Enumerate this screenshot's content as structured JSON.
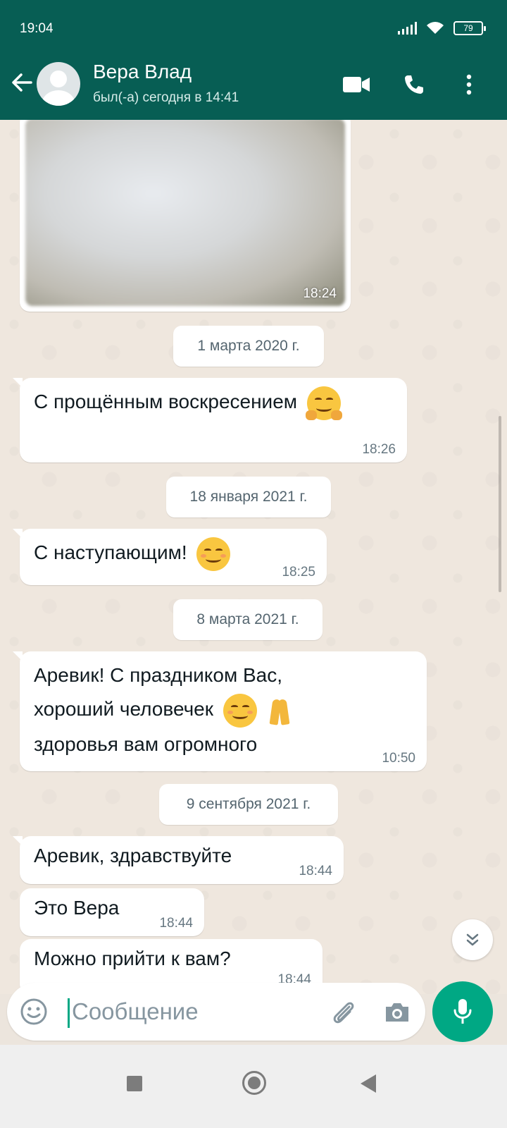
{
  "status_bar": {
    "time": "19:04",
    "battery": "79"
  },
  "header": {
    "contact_name": "Вера Влад",
    "contact_status": "был(-а) сегодня в 14:41",
    "color": "#075E54"
  },
  "chat": {
    "image_message": {
      "time": "18:24"
    },
    "dates": [
      "1 марта 2020 г.",
      "18 января 2021 г.",
      "8 марта 2021 г.",
      "9 сентября 2021 г."
    ],
    "messages": [
      {
        "lines": [
          "С прощённым воскресением"
        ],
        "emoji": "hugging-face",
        "time": "18:26"
      },
      {
        "lines": [
          "С наступающим!"
        ],
        "emoji": "smiling-face",
        "time": "18:25"
      },
      {
        "lines": [
          "Аревик! С праздником Вас,",
          "хороший человечек",
          "здоровья вам огромного"
        ],
        "emoji": "smiling-face, folded-hands",
        "time": "10:50"
      },
      {
        "lines": [
          "Аревик, здравствуйте"
        ],
        "time": "18:44"
      },
      {
        "lines": [
          "Это Вера"
        ],
        "time": "18:44"
      },
      {
        "lines": [
          "Можно прийти к вам?"
        ],
        "time": "18:44"
      }
    ]
  },
  "composer": {
    "placeholder": "Сообщение"
  },
  "accent": "#00A884"
}
